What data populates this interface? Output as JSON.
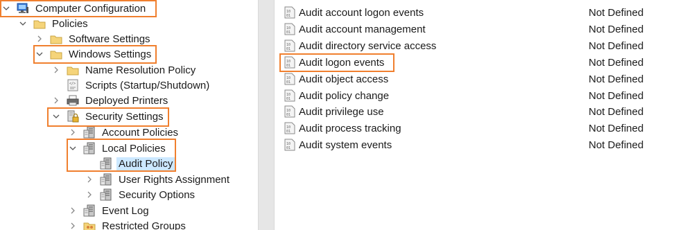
{
  "tree": {
    "computer_configuration": "Computer Configuration",
    "policies": "Policies",
    "software_settings": "Software Settings",
    "windows_settings": "Windows Settings",
    "name_resolution_policy": "Name Resolution Policy",
    "scripts": "Scripts (Startup/Shutdown)",
    "deployed_printers": "Deployed Printers",
    "security_settings": "Security Settings",
    "account_policies": "Account Policies",
    "local_policies": "Local Policies",
    "audit_policy": "Audit Policy",
    "user_rights_assignment": "User Rights Assignment",
    "security_options": "Security Options",
    "event_log": "Event Log",
    "restricted_groups": "Restricted Groups"
  },
  "policies": [
    {
      "name": "Audit account logon events",
      "setting": "Not Defined"
    },
    {
      "name": "Audit account management",
      "setting": "Not Defined"
    },
    {
      "name": "Audit directory service access",
      "setting": "Not Defined"
    },
    {
      "name": "Audit logon events",
      "setting": "Not Defined"
    },
    {
      "name": "Audit object access",
      "setting": "Not Defined"
    },
    {
      "name": "Audit policy change",
      "setting": "Not Defined"
    },
    {
      "name": "Audit privilege use",
      "setting": "Not Defined"
    },
    {
      "name": "Audit process tracking",
      "setting": "Not Defined"
    },
    {
      "name": "Audit system events",
      "setting": "Not Defined"
    }
  ],
  "colors": {
    "highlight_border": "#f07f2e",
    "selection": "#cce8ff",
    "folder": "#f5d47a"
  },
  "icons": {
    "computer": "computer-monitor-icon",
    "folder": "folder-icon",
    "script": "script-icon",
    "printer": "printer-icon",
    "security": "security-lock-icon",
    "policy": "policy-server-icon",
    "setting": "policy-document-icon"
  }
}
